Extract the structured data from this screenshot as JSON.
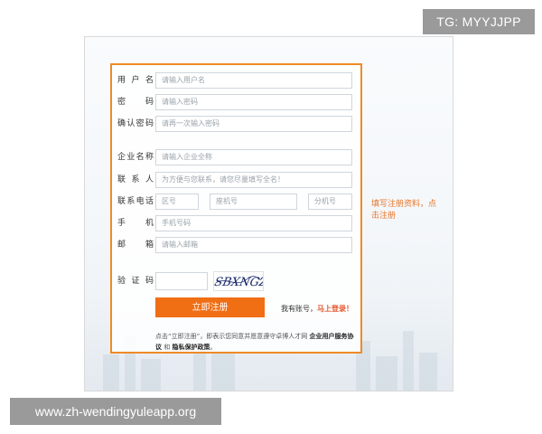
{
  "watermarks": {
    "top": "TG: MYYJJPP",
    "bottom": "www.zh-wendingyuleapp.org"
  },
  "form": {
    "username": {
      "label": "用户名",
      "placeholder": "请输入用户名"
    },
    "password": {
      "label": "密　码",
      "placeholder": "请输入密码"
    },
    "confirm": {
      "label": "确认密码",
      "placeholder": "请再一次输入密码"
    },
    "company": {
      "label": "企业名称",
      "placeholder": "请输入企业全称"
    },
    "contact": {
      "label": "联系人",
      "placeholder": "为方便与您联系，请您尽量填写全名！"
    },
    "phone": {
      "label": "联系电话",
      "area_placeholder": "区号",
      "number_placeholder": "座机号",
      "ext_placeholder": "分机号"
    },
    "mobile": {
      "label": "手　机",
      "placeholder": "手机号码"
    },
    "email": {
      "label": "邮　箱",
      "placeholder": "请输入邮箱"
    },
    "captcha": {
      "label": "验证码",
      "image_text": "SBXNGZ"
    },
    "submit_label": "立即注册",
    "have_account": "我有账号，",
    "login_link": "马上登录！",
    "agreement_prefix": "点击“立即注册”，即表示您同意并愿意遵守卓博人才网",
    "agreement_terms": "企业用户服务协议",
    "agreement_and": "和",
    "agreement_privacy": "隐私保护政策",
    "agreement_end": "。"
  },
  "side_tip": "填写注册资料，点击注册",
  "colors": {
    "accent": "#f08a24",
    "button": "#f06e14",
    "link": "#e4572e"
  }
}
